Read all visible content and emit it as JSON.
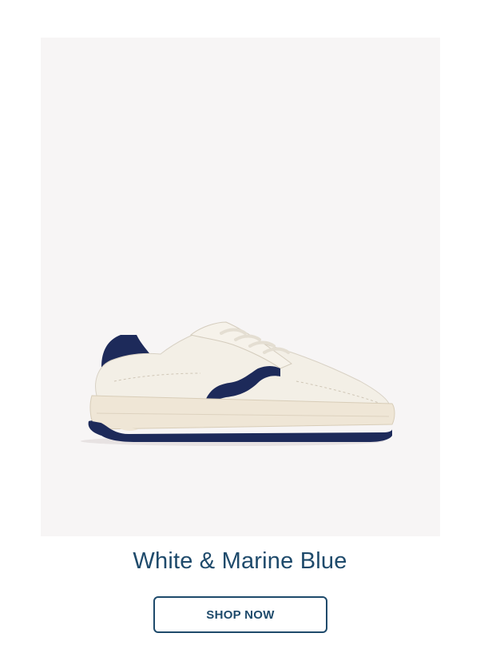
{
  "product": {
    "image_name": "sneaker-image",
    "title": "White & Marine Blue",
    "button_label": "SHOP NOW"
  },
  "colors": {
    "image_background": "#f7f5f5",
    "title_text": "#1e4a6b",
    "button_border": "#1e4a6b",
    "shoe_upper": "#f3efe6",
    "shoe_sole": "#efe6d6",
    "shoe_accent": "#1d2a5a"
  }
}
